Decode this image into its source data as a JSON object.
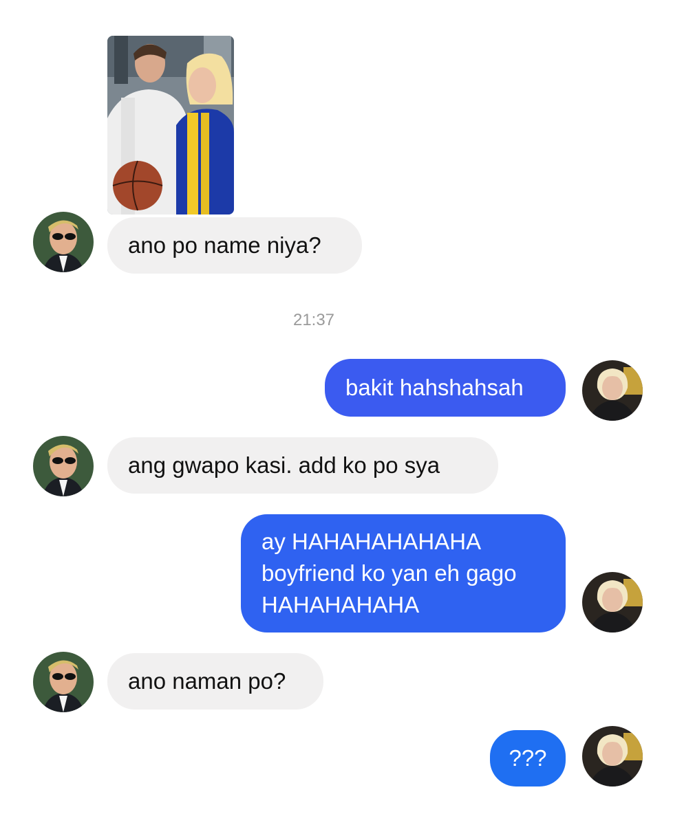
{
  "colors": {
    "incoming_bubble": "#f1f0f0",
    "outgoing_bubble_a": "#3b5bf0",
    "outgoing_bubble_b": "#1f6ff2",
    "timestamp_text": "#9a9a9a"
  },
  "timestamp": "21:37",
  "messages": [
    {
      "sender": "other",
      "type": "image",
      "icon": "photo-couple-image"
    },
    {
      "sender": "other",
      "text": "ano po name niya?"
    },
    {
      "sender": "me",
      "text": "bakit hahshahsah"
    },
    {
      "sender": "other",
      "text": "ang gwapo kasi. add ko po sya"
    },
    {
      "sender": "me",
      "lines": [
        "ay HAHAHAHAHAHA",
        "boyfriend ko yan eh gago",
        "HAHAHAHAHA"
      ]
    },
    {
      "sender": "other",
      "text": "ano naman po?"
    },
    {
      "sender": "me",
      "text": "???"
    }
  ]
}
